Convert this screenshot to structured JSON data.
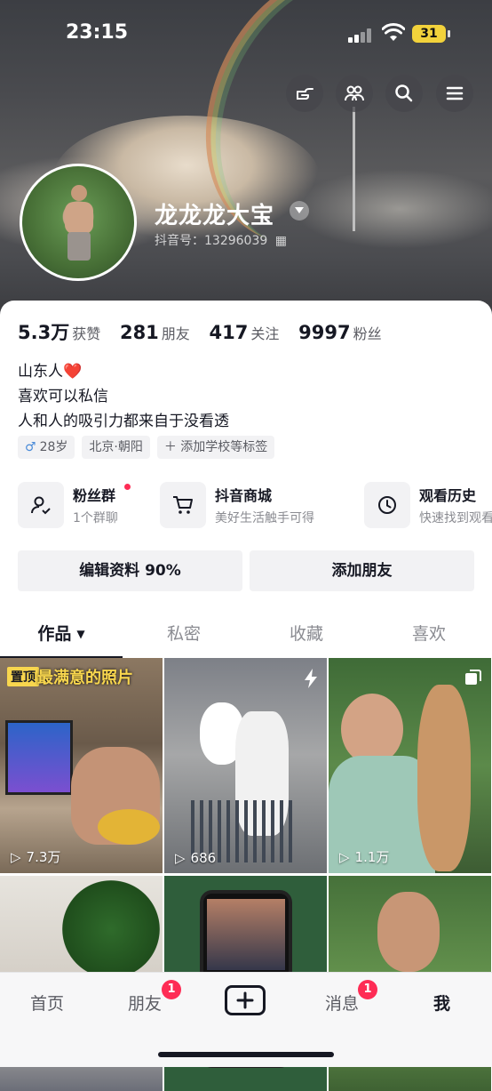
{
  "status_bar": {
    "time": "23:15",
    "battery": "31"
  },
  "profile": {
    "username": "龙龙龙大宝",
    "douyin_id": "抖音号：13296039",
    "stats": [
      {
        "value": "5.3万",
        "label": "获赞"
      },
      {
        "value": "281",
        "label": "朋友"
      },
      {
        "value": "417",
        "label": "关注"
      },
      {
        "value": "9997",
        "label": "粉丝"
      }
    ],
    "bio": [
      "山东人❤️",
      "喜欢可以私信",
      "人和人的吸引力都来自于没看透"
    ],
    "tags": {
      "gender_age": "28岁",
      "location": "北京·朝阳",
      "add_tag": "添加学校等标签"
    }
  },
  "shortcuts": [
    {
      "title": "粉丝群",
      "subtitle": "1个群聊",
      "icon": "fan-group-icon"
    },
    {
      "title": "抖音商城",
      "subtitle": "美好生活触手可得",
      "icon": "cart-icon"
    },
    {
      "title": "观看历史",
      "subtitle": "快速找到观看",
      "icon": "clock-icon"
    }
  ],
  "buttons": {
    "edit_profile": "编辑资料 90%",
    "add_friend": "添加朋友"
  },
  "tabs": [
    {
      "label": "作品",
      "active": true
    },
    {
      "label": "私密",
      "active": false
    },
    {
      "label": "收藏",
      "active": false
    },
    {
      "label": "喜欢",
      "active": false
    }
  ],
  "videos": [
    {
      "views": "7.3万",
      "pinned_label": "置顶",
      "title": "最满意的照片"
    },
    {
      "views": "686",
      "icon": "flash-icon"
    },
    {
      "views": "1.1万",
      "icon": "multi-image-icon"
    },
    {
      "views": ""
    },
    {
      "views": ""
    },
    {
      "views": ""
    }
  ],
  "bottom_nav": {
    "home": "首页",
    "friends": "朋友",
    "friends_badge": "1",
    "messages": "消息",
    "messages_badge": "1",
    "me": "我"
  }
}
